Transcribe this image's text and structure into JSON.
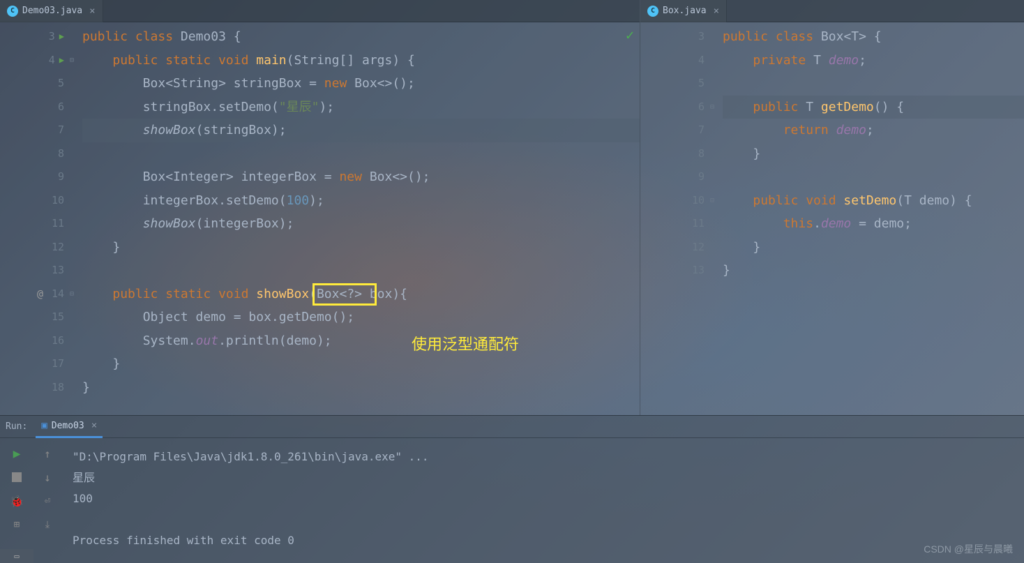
{
  "left_tab": {
    "label": "Demo03.java",
    "icon_letter": "C"
  },
  "right_tab": {
    "label": "Box.java",
    "icon_letter": "C"
  },
  "left_gutter": [
    "3",
    "4",
    "5",
    "6",
    "7",
    "8",
    "9",
    "10",
    "11",
    "12",
    "13",
    "14",
    "15",
    "16",
    "17",
    "18"
  ],
  "left_code": {
    "l3": {
      "indent": "",
      "kw1": "public ",
      "kw2": "class ",
      "name": "Demo03 ",
      "brace": "{"
    },
    "l4": {
      "indent": "    ",
      "kw1": "public ",
      "kw2": "static ",
      "kw3": "void ",
      "method": "main",
      "params": "(String[] args) {"
    },
    "l5": {
      "indent": "        ",
      "t1": "Box<String> stringBox = ",
      "kw": "new ",
      "t2": "Box<>();"
    },
    "l6": {
      "indent": "        ",
      "t1": "stringBox.setDemo(",
      "str": "\"星辰\"",
      "t2": ");"
    },
    "l7": {
      "indent": "        ",
      "m": "showBox",
      "t": "(stringBox);"
    },
    "l8": {
      "indent": ""
    },
    "l9": {
      "indent": "        ",
      "t1": "Box<Integer> integerBox = ",
      "kw": "new ",
      "t2": "Box<>();"
    },
    "l10": {
      "indent": "        ",
      "t1": "integerBox.setDemo(",
      "num": "100",
      "t2": ");"
    },
    "l11": {
      "indent": "        ",
      "m": "showBox",
      "t": "(integerBox);"
    },
    "l12": {
      "indent": "    ",
      "brace": "}"
    },
    "l13": {
      "indent": ""
    },
    "l14": {
      "indent": "    ",
      "kw1": "public ",
      "kw2": "static ",
      "kw3": "void ",
      "method": "showBox",
      "p1": "(",
      "boxed": "Box<?>",
      "p2": " box){"
    },
    "l15": {
      "indent": "        ",
      "t": "Object demo = box.getDemo();"
    },
    "l16": {
      "indent": "        ",
      "t1": "System.",
      "f": "out",
      "t2": ".println(demo);"
    },
    "l17": {
      "indent": "    ",
      "brace": "}"
    },
    "l18": {
      "indent": "",
      "brace": "}"
    }
  },
  "right_gutter": [
    "3",
    "4",
    "5",
    "6",
    "7",
    "8",
    "9",
    "10",
    "11",
    "12",
    "13"
  ],
  "right_code": {
    "l3": {
      "indent": "",
      "kw1": "public ",
      "kw2": "class ",
      "name": "Box",
      "gen": "<T> {"
    },
    "l4": {
      "indent": "    ",
      "kw": "private ",
      "t": "T ",
      "f": "demo",
      "semi": ";"
    },
    "l5": {
      "indent": ""
    },
    "l6": {
      "indent": "    ",
      "kw": "public ",
      "t": "T ",
      "m": "getDemo",
      "p": "() {"
    },
    "l7": {
      "indent": "        ",
      "kw": "return ",
      "f": "demo",
      "semi": ";"
    },
    "l8": {
      "indent": "    ",
      "brace": "}"
    },
    "l9": {
      "indent": ""
    },
    "l10": {
      "indent": "    ",
      "kw1": "public ",
      "kw2": "void ",
      "m": "setDemo",
      "p": "(T demo) {"
    },
    "l11": {
      "indent": "        ",
      "kw": "this",
      "dot": ".",
      "f": "demo",
      "t": " = demo;"
    },
    "l12": {
      "indent": "    ",
      "brace": "}"
    },
    "l13": {
      "indent": "",
      "brace": "}"
    }
  },
  "annotation": "使用泛型通配符",
  "run": {
    "label": "Run:",
    "tab_label": "Demo03",
    "output_cmd": "\"D:\\Program Files\\Java\\jdk1.8.0_261\\bin\\java.exe\" ...",
    "output_line1": "星辰",
    "output_line2": "100",
    "output_exit": "Process finished with exit code 0"
  },
  "watermark": "CSDN @星辰与晨曦"
}
